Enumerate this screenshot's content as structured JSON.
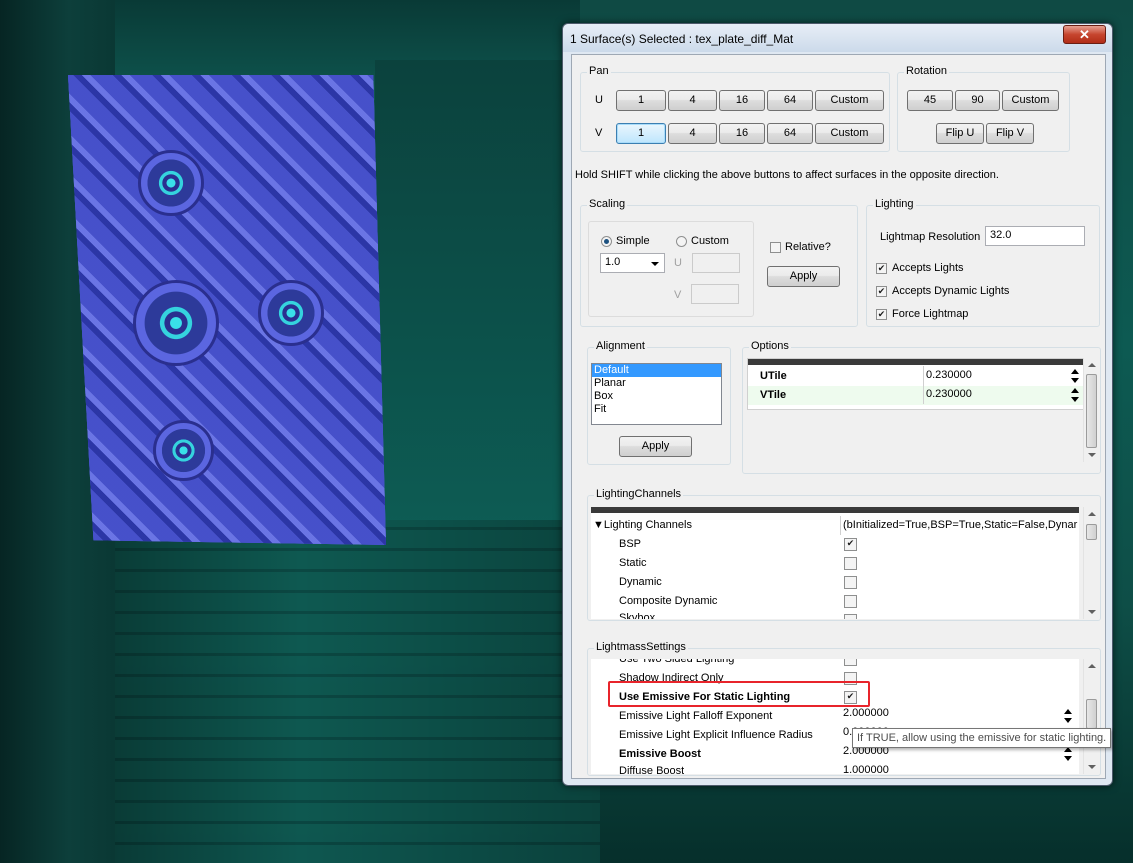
{
  "window": {
    "title": "1 Surface(s) Selected : tex_plate_diff_Mat",
    "close": "✕"
  },
  "pan": {
    "label": "Pan",
    "u_label": "U",
    "v_label": "V",
    "u_buttons": [
      "1",
      "4",
      "16",
      "64",
      "Custom"
    ],
    "v_buttons": [
      "1",
      "4",
      "16",
      "64",
      "Custom"
    ]
  },
  "rotation": {
    "label": "Rotation",
    "buttons": [
      "45",
      "90",
      "Custom"
    ],
    "flip_u": "Flip U",
    "flip_v": "Flip V"
  },
  "hint": "Hold SHIFT while clicking the above buttons to affect surfaces in the opposite direction.",
  "scaling": {
    "label": "Scaling",
    "simple": "Simple",
    "custom": "Custom",
    "simple_value": "1.0",
    "u_label": "U",
    "v_label": "V",
    "relative": "Relative?",
    "apply": "Apply"
  },
  "lighting": {
    "label": "Lighting",
    "lightmap_resolution_label": "Lightmap Resolution",
    "lightmap_resolution_value": "32.0",
    "accepts_lights": "Accepts Lights",
    "accepts_dynamic_lights": "Accepts Dynamic Lights",
    "force_lightmap": "Force Lightmap"
  },
  "alignment": {
    "label": "Alignment",
    "items": [
      "Default",
      "Planar",
      "Box",
      "Fit"
    ],
    "apply": "Apply"
  },
  "options": {
    "label": "Options",
    "rows": [
      {
        "name": "UTile",
        "value": "0.230000"
      },
      {
        "name": "VTile",
        "value": "0.230000"
      }
    ]
  },
  "lighting_channels": {
    "label": "LightingChannels",
    "header": "Lighting Channels",
    "header_value": "(bInitialized=True,BSP=True,Static=False,Dynar",
    "items": [
      {
        "name": "BSP",
        "checked": true
      },
      {
        "name": "Static",
        "checked": false
      },
      {
        "name": "Dynamic",
        "checked": false
      },
      {
        "name": "Composite Dynamic",
        "checked": false
      },
      {
        "name": "Skybox",
        "checked": false
      }
    ]
  },
  "lightmass": {
    "label": "LightmassSettings",
    "rows": [
      {
        "name": "Use Two Sided Lighting",
        "value": ""
      },
      {
        "name": "Shadow Indirect Only",
        "value": ""
      },
      {
        "name": "Use Emissive For Static Lighting",
        "value": ""
      },
      {
        "name": "Emissive Light Falloff Exponent",
        "value": "2.000000"
      },
      {
        "name": "Emissive Light Explicit Influence Radius",
        "value": "0.000000"
      },
      {
        "name": "Emissive Boost",
        "value": "2.000000"
      },
      {
        "name": "Diffuse Boost",
        "value": "1.000000"
      }
    ]
  },
  "tooltip": "If TRUE, allow using the emissive for static lighting."
}
